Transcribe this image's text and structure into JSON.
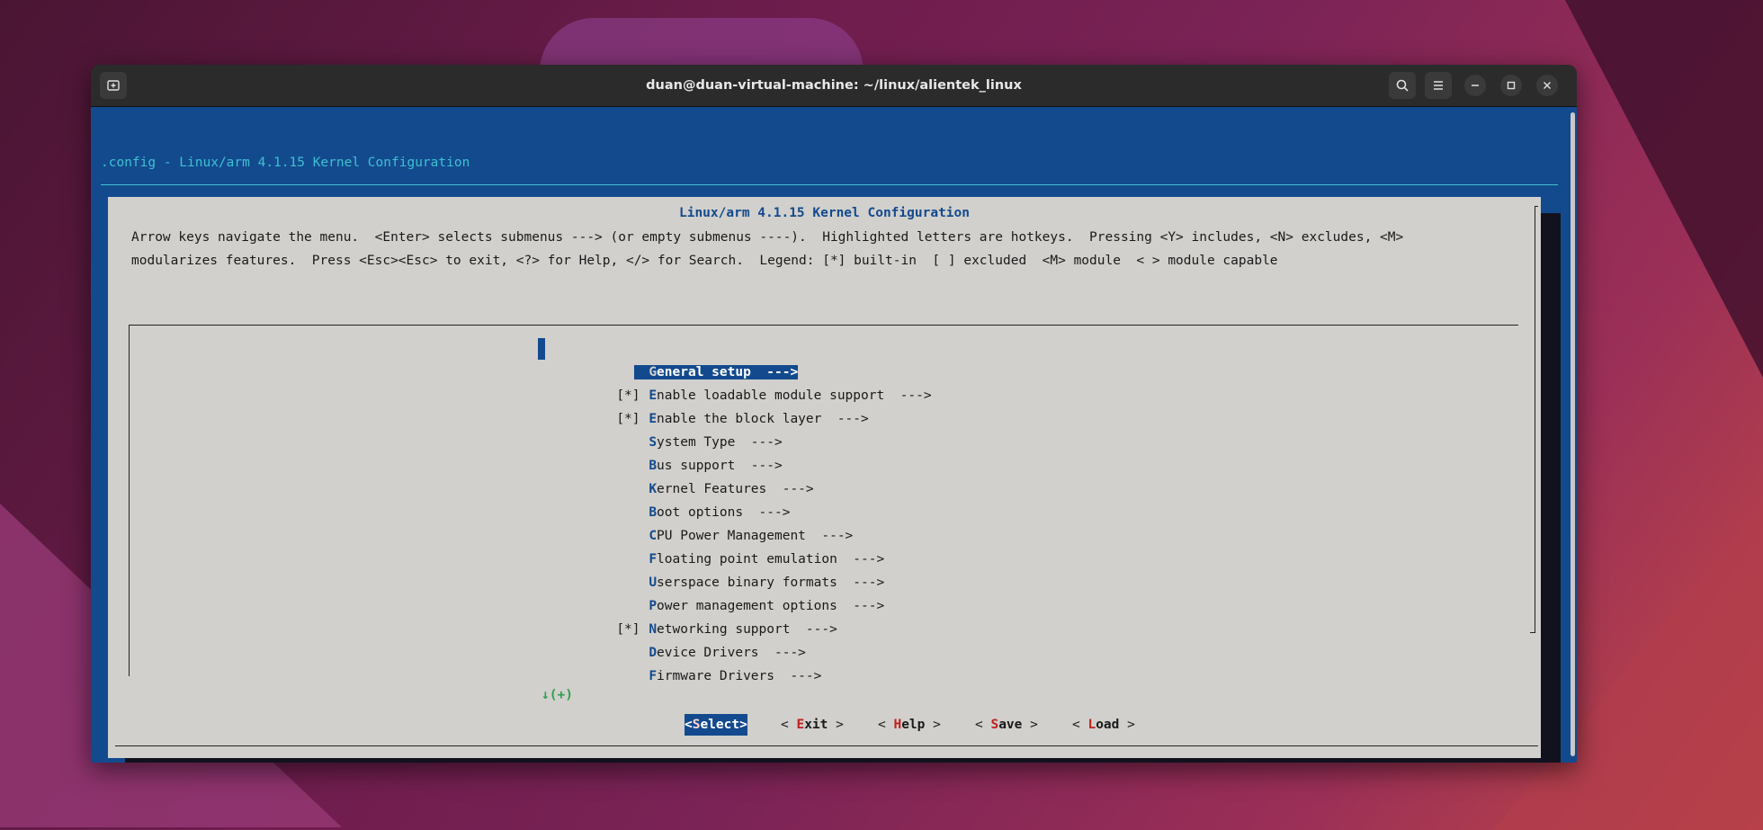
{
  "window": {
    "title": "duan@duan-virtual-machine: ~/linux/alientek_linux",
    "new_tab_icon": "new-tab-icon",
    "search_icon": "search-icon",
    "menu_icon": "hamburger-menu-icon",
    "minimize_icon": "minimize-icon",
    "maximize_icon": "maximize-icon",
    "close_icon": "close-icon"
  },
  "terminal": {
    "config_title": ".config - Linux/arm 4.1.15 Kernel Configuration",
    "dialog_title": "Linux/arm 4.1.15 Kernel Configuration",
    "help_line1": "Arrow keys navigate the menu.  <Enter> selects submenus ---> (or empty submenus ----).  Highlighted letters are hotkeys.  Pressing <Y> includes, <N> excludes, <M>",
    "help_line2": "modularizes features.  Press <Esc><Esc> to exit, <?> for Help, </> for Search.  Legend: [*] built-in  [ ] excluded  <M> module  < > module capable",
    "more_indicator": "↓(+)",
    "colors": {
      "background_blue": "#134a8e",
      "dialog_gray": "#d1d0cc",
      "title_cyan": "#3ec1d0",
      "hotkey_red": "#c02020"
    }
  },
  "menu": {
    "items": [
      {
        "mark": "",
        "hotkey": "G",
        "rest": "eneral setup  --->",
        "selected": true
      },
      {
        "mark": "[*]",
        "hotkey": "E",
        "rest": "nable loadable module support  --->",
        "selected": false
      },
      {
        "mark": "[*]",
        "hotkey": "E",
        "rest": "nable the block layer  --->",
        "selected": false
      },
      {
        "mark": "",
        "hotkey": "S",
        "rest": "ystem Type  --->",
        "selected": false
      },
      {
        "mark": "",
        "hotkey": "B",
        "rest": "us support  --->",
        "selected": false
      },
      {
        "mark": "",
        "hotkey": "K",
        "rest": "ernel Features  --->",
        "selected": false
      },
      {
        "mark": "",
        "hotkey": "B",
        "rest": "oot options  --->",
        "selected": false
      },
      {
        "mark": "",
        "hotkey": "C",
        "rest": "PU Power Management  --->",
        "selected": false
      },
      {
        "mark": "",
        "hotkey": "F",
        "rest": "loating point emulation  --->",
        "selected": false
      },
      {
        "mark": "",
        "hotkey": "U",
        "rest": "serspace binary formats  --->",
        "selected": false
      },
      {
        "mark": "",
        "hotkey": "P",
        "rest": "ower management options  --->",
        "selected": false
      },
      {
        "mark": "[*]",
        "hotkey": "N",
        "rest": "etworking support  --->",
        "selected": false
      },
      {
        "mark": "",
        "hotkey": "D",
        "rest": "evice Drivers  --->",
        "selected": false
      },
      {
        "mark": "",
        "hotkey": "F",
        "rest": "irmware Drivers  --->",
        "selected": false
      }
    ]
  },
  "buttons": {
    "select": {
      "pre": "<",
      "hotkey": "S",
      "rest": "elect",
      "post": ">"
    },
    "exit": {
      "pre": "< ",
      "hotkey": "E",
      "rest": "xit",
      "post": " >"
    },
    "help": {
      "pre": "< ",
      "hotkey": "H",
      "rest": "elp",
      "post": " >"
    },
    "save": {
      "pre": "< ",
      "hotkey": "S",
      "rest": "ave",
      "post": " >"
    },
    "load": {
      "pre": "< ",
      "hotkey": "L",
      "rest": "oad",
      "post": " >"
    }
  }
}
